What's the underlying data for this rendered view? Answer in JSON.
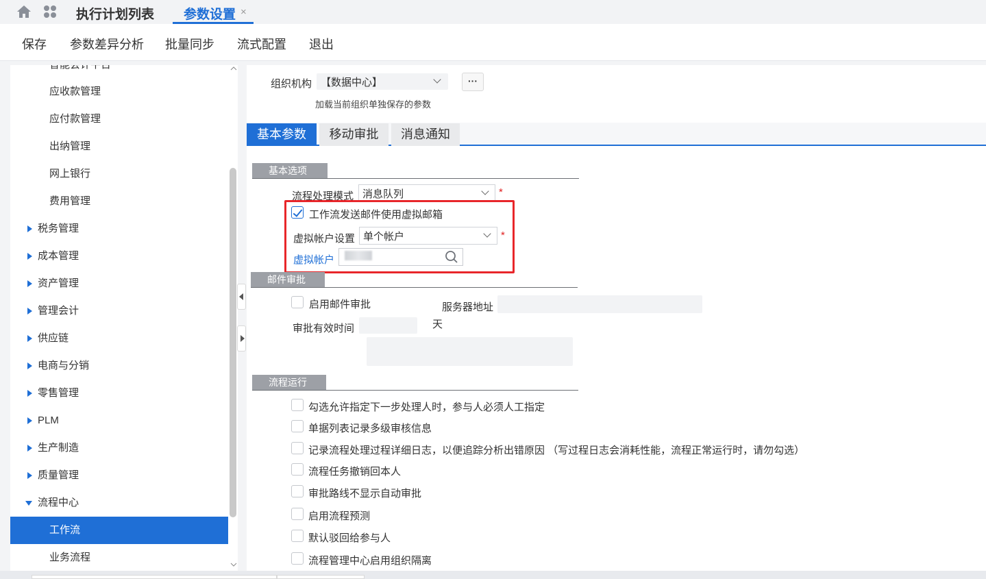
{
  "topbar": {
    "tab_plan_list": "执行计划列表",
    "tab_param_settings": "参数设置",
    "close_glyph": "×"
  },
  "toolbar": {
    "save": "保存",
    "diff_analysis": "参数差异分析",
    "batch_sync": "批量同步",
    "flow_config": "流式配置",
    "exit": "退出"
  },
  "tree": {
    "items": [
      {
        "label": "智能会计平台",
        "level": 2
      },
      {
        "label": "应收款管理",
        "level": 2
      },
      {
        "label": "应付款管理",
        "level": 2
      },
      {
        "label": "出纳管理",
        "level": 2
      },
      {
        "label": "网上银行",
        "level": 2
      },
      {
        "label": "费用管理",
        "level": 2
      },
      {
        "label": "税务管理",
        "level": 1
      },
      {
        "label": "成本管理",
        "level": 1
      },
      {
        "label": "资产管理",
        "level": 1
      },
      {
        "label": "管理会计",
        "level": 1
      },
      {
        "label": "供应链",
        "level": 1
      },
      {
        "label": "电商与分销",
        "level": 1
      },
      {
        "label": "零售管理",
        "level": 1
      },
      {
        "label": "PLM",
        "level": 1
      },
      {
        "label": "生产制造",
        "level": 1
      },
      {
        "label": "质量管理",
        "level": 1
      },
      {
        "label": "流程中心",
        "level": 1,
        "expanded": true
      },
      {
        "label": "工作流",
        "level": 2,
        "active": true
      },
      {
        "label": "业务流程",
        "level": 2
      }
    ]
  },
  "org": {
    "label": "组织机构",
    "value": "【数据中心】",
    "more": "···",
    "hint": "加载当前组织单独保存的参数"
  },
  "tabs": {
    "basic": "基本参数",
    "mobile": "移动审批",
    "notice": "消息通知"
  },
  "basic_options": {
    "title": "基本选项",
    "mode_label": "流程处理模式",
    "mode_value": "消息队列",
    "virtual_mail_label": "工作流发送邮件使用虚拟邮箱",
    "virtual_mail_checked": true,
    "account_setting_label": "虚拟帐户设置",
    "account_setting_value": "单个帐户",
    "account_label": "虚拟帐户",
    "required_mark": "*"
  },
  "mail_approval": {
    "title": "邮件审批",
    "enable_label": "启用邮件审批",
    "server_label": "服务器地址",
    "valid_label": "审批有效时间",
    "day_unit": "天"
  },
  "flow_run": {
    "title": "流程运行",
    "options": [
      "勾选允许指定下一步处理人时，参与人必须人工指定",
      "单据列表记录多级审核信息",
      "记录流程处理过程详细日志，以便追踪分析出错原因 （写过程日志会消耗性能，流程正常运行时，请勿勾选）",
      "流程任务撤销回本人",
      "审批路线不显示自动审批",
      "启用流程预测",
      "默认驳回给参与人",
      "流程管理中心启用组织隔离"
    ]
  },
  "colors": {
    "accent": "#1f6fd6",
    "highlight": "#e8262a",
    "section": "#9da0a6"
  }
}
